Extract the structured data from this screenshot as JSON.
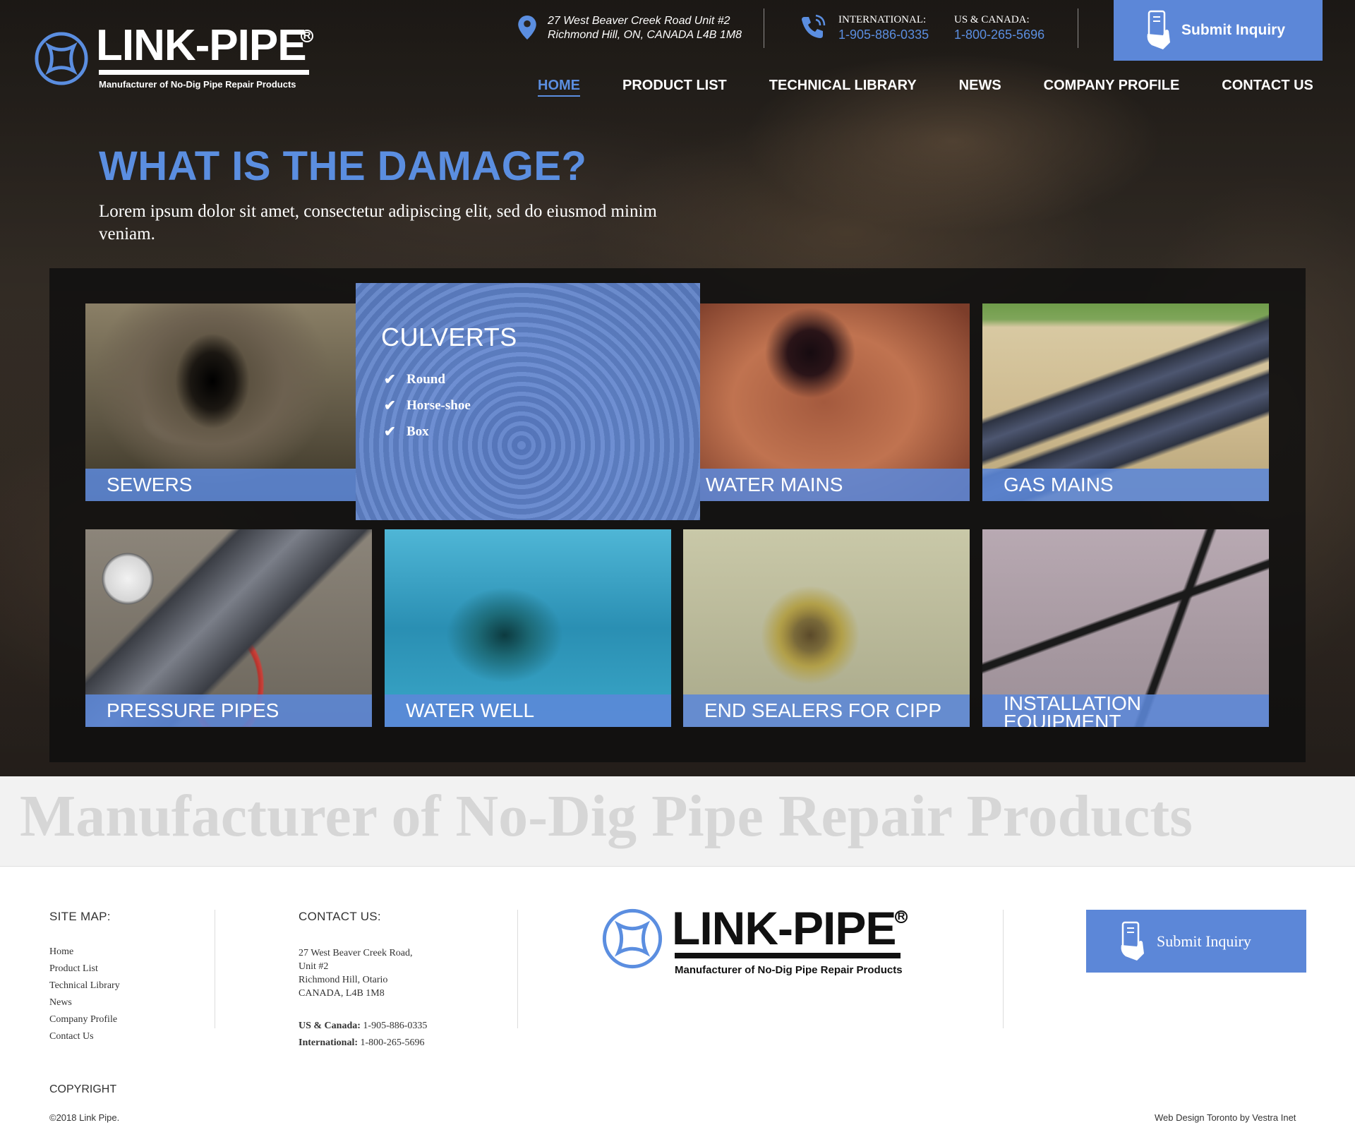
{
  "header": {
    "logo": {
      "word": "LINK-PIPE",
      "reg": "R",
      "tagline": "Manufacturer of No-Dig Pipe Repair Products"
    },
    "address": {
      "line1": "27 West Beaver Creek Road Unit #2",
      "line2": "Richmond Hill, ON, CANADA L4B 1M8"
    },
    "phones": {
      "international": {
        "label": "INTERNATIONAL:",
        "number": "1-905-886-0335"
      },
      "us_canada": {
        "label": "US & CANADA:",
        "number": "1-800-265-5696"
      }
    },
    "inquiry_label": "Submit Inquiry"
  },
  "nav": {
    "items": [
      {
        "label": "HOME",
        "active": true
      },
      {
        "label": "PRODUCT LIST"
      },
      {
        "label": "TECHNICAL LIBRARY"
      },
      {
        "label": "NEWS"
      },
      {
        "label": "COMPANY PROFILE"
      },
      {
        "label": "CONTACT US"
      }
    ]
  },
  "hero": {
    "headline": "WHAT IS THE DAMAGE?",
    "subline": "Lorem ipsum dolor sit amet, consectetur adipiscing elit, sed do eiusmod minim veniam."
  },
  "tiles": [
    {
      "label": "SEWERS"
    },
    {
      "label": "WATER MAINS"
    },
    {
      "label": "GAS MAINS"
    },
    {
      "label": "PRESSURE PIPES"
    },
    {
      "label": "WATER WELL"
    },
    {
      "label": "END SEALERS FOR CIPP"
    },
    {
      "label_line1": "INSTALLATION",
      "label_line2": "EQUIPMENT"
    }
  ],
  "culverts": {
    "title": "CULVERTS",
    "items": [
      "Round",
      "Horse-shoe",
      "Box"
    ]
  },
  "banner": {
    "text": "Manufacturer of No-Dig Pipe Repair Products"
  },
  "footer": {
    "sitemap_heading": "SITE MAP:",
    "sitemap_links": [
      "Home",
      "Product List",
      "Technical Library",
      "News",
      "Company Profile",
      "Contact Us"
    ],
    "contact_heading": "CONTACT US:",
    "address_lines": [
      "27 West Beaver Creek Road,",
      "Unit #2",
      "Richmond Hill, Otario",
      "CANADA, L4B 1M8"
    ],
    "phone_us_label": "US & Canada:",
    "phone_us": "1-905-886-0335",
    "phone_intl_label": "International:",
    "phone_intl": "1-800-265-5696",
    "inquiry_label": "Submit Inquiry",
    "copyright_heading": "COPYRIGHT",
    "copyright": "©2018 Link Pipe.",
    "credit": "Web Design Toronto by Vestra Inet"
  },
  "colors": {
    "accent": "#5c87d8",
    "link_blue": "#5b8ee0",
    "banner_text": "#d6d6d6"
  },
  "icons": [
    "logo-ring-icon",
    "map-pin-icon",
    "phone-icon",
    "hand-phone-icon",
    "checkmark-icon"
  ]
}
